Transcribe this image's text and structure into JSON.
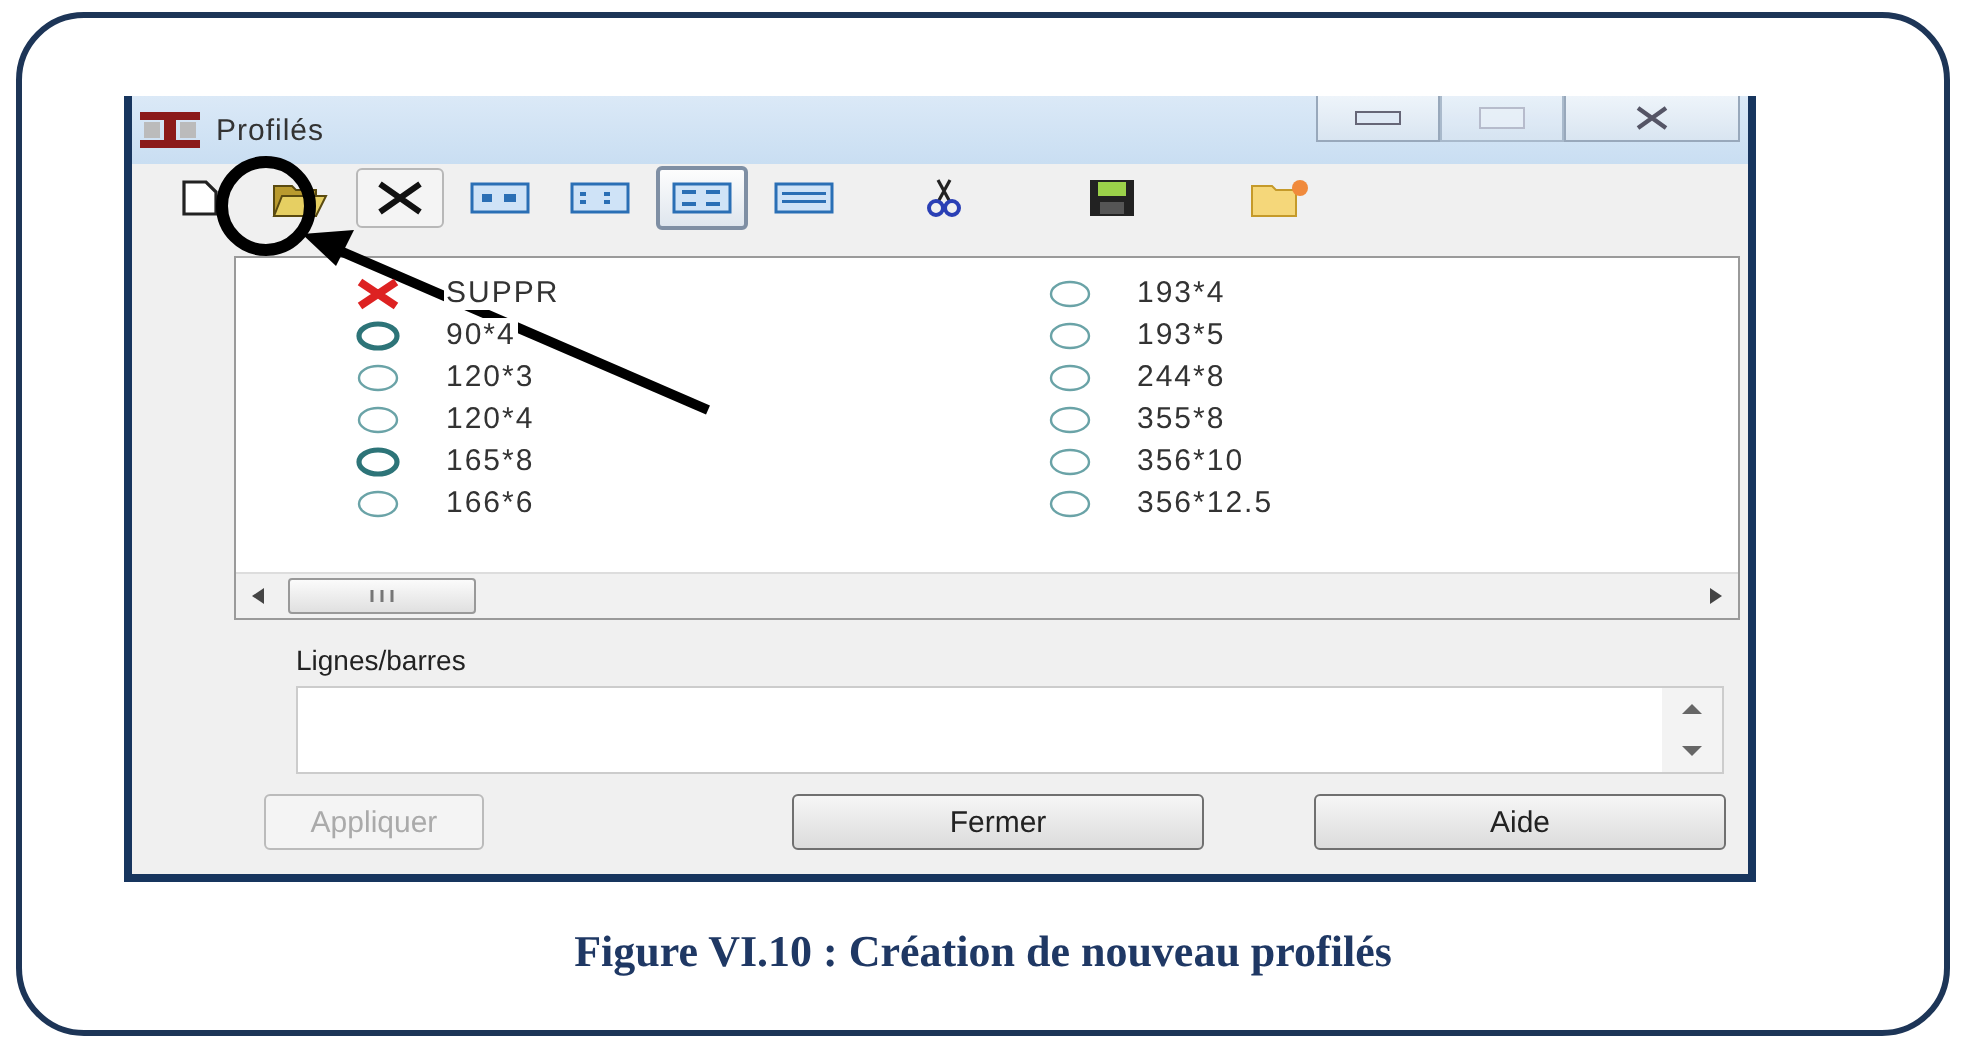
{
  "window": {
    "title": "Profilés",
    "controls": [
      {
        "kind": "minimize",
        "disabled": false
      },
      {
        "kind": "maximize",
        "disabled": true
      },
      {
        "kind": "close",
        "disabled": false
      }
    ]
  },
  "toolbar": [
    {
      "kind": "new",
      "selected": false
    },
    {
      "kind": "open",
      "selected": false
    },
    {
      "kind": "delete",
      "selected": false
    },
    {
      "kind": "view-large",
      "selected": false
    },
    {
      "kind": "view-small",
      "selected": false
    },
    {
      "kind": "view-list",
      "selected": true
    },
    {
      "kind": "view-details",
      "selected": false
    },
    {
      "kind": "cut",
      "selected": false
    },
    {
      "kind": "save",
      "selected": false
    },
    {
      "kind": "tag",
      "selected": false
    }
  ],
  "profiles": {
    "columns": [
      [
        {
          "kind": "delete",
          "label": "SUPPR",
          "active": false
        },
        {
          "kind": "profile",
          "label": "90*4",
          "active": true
        },
        {
          "kind": "profile",
          "label": "120*3",
          "active": false
        },
        {
          "kind": "profile",
          "label": "120*4",
          "active": false
        },
        {
          "kind": "profile",
          "label": "165*8",
          "active": true
        },
        {
          "kind": "profile",
          "label": "166*6",
          "active": false
        }
      ],
      [
        {
          "kind": "profile",
          "label": "193*4",
          "active": false
        },
        {
          "kind": "profile",
          "label": "193*5",
          "active": false
        },
        {
          "kind": "profile",
          "label": "244*8",
          "active": false
        },
        {
          "kind": "profile",
          "label": "355*8",
          "active": false
        },
        {
          "kind": "profile",
          "label": "356*10",
          "active": false
        },
        {
          "kind": "profile",
          "label": "356*12.5",
          "active": false
        }
      ]
    ]
  },
  "group": {
    "label": "Lignes/barres"
  },
  "buttons": [
    {
      "label": "Appliquer",
      "disabled": true
    },
    {
      "label": "Fermer",
      "disabled": false
    },
    {
      "label": "Aide",
      "disabled": false
    }
  ],
  "caption": "Figure VI.10 : Création de nouveau profilés"
}
